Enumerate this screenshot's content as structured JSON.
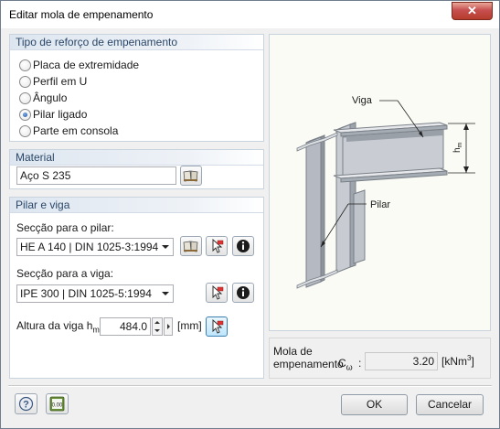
{
  "window": {
    "title": "Editar mola de empenamento",
    "close_label": "✕"
  },
  "stiffening_type": {
    "heading": "Tipo de reforço de empenamento",
    "options": [
      {
        "label": "Placa de extremidade",
        "checked": false
      },
      {
        "label": "Perfil em U",
        "checked": false
      },
      {
        "label": "Ângulo",
        "checked": false
      },
      {
        "label": "Pilar ligado",
        "checked": true
      },
      {
        "label": "Parte em consola",
        "checked": false
      }
    ]
  },
  "material": {
    "heading": "Material",
    "value": "Aço S 235"
  },
  "column_beam": {
    "heading": "Pilar e viga",
    "column_section_label": "Secção para o pilar:",
    "column_section_value": "HE A 140 | DIN 1025-3:1994",
    "beam_section_label": "Secção para a viga:",
    "beam_section_value": "IPE 300 | DIN 1025-5:1994",
    "beam_height_label": "Altura da viga h",
    "beam_height_sub": "m",
    "beam_height_value": "484.0",
    "beam_height_unit": "[mm]"
  },
  "figure": {
    "label_beam": "Viga",
    "label_column": "Pilar",
    "label_hm": "h",
    "label_hm_sub": "m"
  },
  "result": {
    "label_line1": "Mola de",
    "label_line2": "empenamento",
    "symbol": "C",
    "symbol_sub": "ω",
    "colon": ":",
    "value": "3.20",
    "unit": "[kNm",
    "unit_sup": "3",
    "unit_close": "]"
  },
  "footer": {
    "ok_label": "OK",
    "cancel_label": "Cancelar",
    "calc_icon_text": "0.00"
  }
}
